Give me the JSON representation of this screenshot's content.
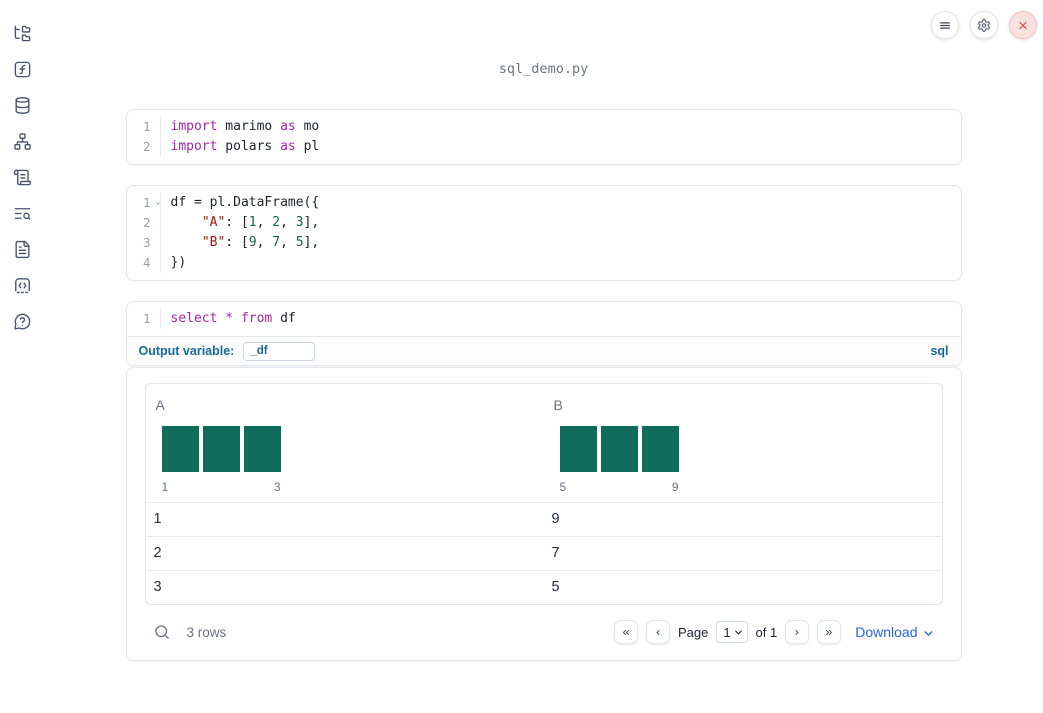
{
  "app": {
    "title": "sql_demo.py"
  },
  "topbar": {
    "buttons": [
      {
        "name": "menu",
        "icon": "hamburger-menu-icon"
      },
      {
        "name": "settings",
        "icon": "gear-icon"
      },
      {
        "name": "shutdown",
        "icon": "close-x-icon"
      }
    ]
  },
  "sidebar": {
    "items": [
      {
        "name": "file-explorer",
        "icon": "file-tree-icon"
      },
      {
        "name": "variables",
        "icon": "function-square-icon"
      },
      {
        "name": "data-sources",
        "icon": "database-icon"
      },
      {
        "name": "dependency-graph",
        "icon": "network-icon"
      },
      {
        "name": "scratchpad",
        "icon": "scroll-icon"
      },
      {
        "name": "logs",
        "icon": "text-search-icon"
      },
      {
        "name": "documentation",
        "icon": "file-text-icon"
      },
      {
        "name": "snippets",
        "icon": "code-box-icon"
      },
      {
        "name": "help",
        "icon": "help-bubble-icon"
      }
    ]
  },
  "cells": [
    {
      "name": "imports-cell",
      "lines": [
        {
          "no": "1",
          "tokens": [
            {
              "c": "kw",
              "t": "import"
            },
            {
              "c": "pl",
              "t": " marimo "
            },
            {
              "c": "kw",
              "t": "as"
            },
            {
              "c": "pl",
              "t": " mo"
            }
          ]
        },
        {
          "no": "2",
          "tokens": [
            {
              "c": "kw",
              "t": "import"
            },
            {
              "c": "pl",
              "t": " polars "
            },
            {
              "c": "kw",
              "t": "as"
            },
            {
              "c": "pl",
              "t": " pl"
            }
          ]
        }
      ]
    },
    {
      "name": "dataframe-cell",
      "lines": [
        {
          "no": "1",
          "fold": true,
          "tokens": [
            {
              "c": "pl",
              "t": "df = pl.DataFrame({"
            }
          ]
        },
        {
          "no": "2",
          "tokens": [
            {
              "c": "pl",
              "t": "    "
            },
            {
              "c": "str",
              "t": "\"A\""
            },
            {
              "c": "pl",
              "t": ": ["
            },
            {
              "c": "num",
              "t": "1"
            },
            {
              "c": "pl",
              "t": ", "
            },
            {
              "c": "num",
              "t": "2"
            },
            {
              "c": "pl",
              "t": ", "
            },
            {
              "c": "num",
              "t": "3"
            },
            {
              "c": "pl",
              "t": "],"
            }
          ]
        },
        {
          "no": "3",
          "tokens": [
            {
              "c": "pl",
              "t": "    "
            },
            {
              "c": "str",
              "t": "\"B\""
            },
            {
              "c": "pl",
              "t": ": ["
            },
            {
              "c": "num",
              "t": "9"
            },
            {
              "c": "pl",
              "t": ", "
            },
            {
              "c": "num",
              "t": "7"
            },
            {
              "c": "pl",
              "t": ", "
            },
            {
              "c": "num",
              "t": "5"
            },
            {
              "c": "pl",
              "t": "],"
            }
          ]
        },
        {
          "no": "4",
          "tokens": [
            {
              "c": "pl",
              "t": "})"
            }
          ]
        }
      ]
    },
    {
      "name": "sql-cell",
      "lines": [
        {
          "no": "1",
          "tokens": [
            {
              "c": "kw",
              "t": "select"
            },
            {
              "c": "pl",
              "t": " "
            },
            {
              "c": "kw",
              "t": "*"
            },
            {
              "c": "pl",
              "t": " "
            },
            {
              "c": "kw",
              "t": "from"
            },
            {
              "c": "pl",
              "t": " df"
            }
          ]
        }
      ],
      "footer": {
        "label": "Output variable:",
        "value": "_df",
        "badge": "sql"
      }
    }
  ],
  "table": {
    "columns": [
      {
        "label": "A",
        "hist": {
          "values": [
            1,
            1,
            1
          ],
          "min_label": "1",
          "max_label": "3"
        }
      },
      {
        "label": "B",
        "hist": {
          "values": [
            1,
            1,
            1
          ],
          "min_label": "5",
          "max_label": "9"
        }
      }
    ],
    "rows": [
      [
        "1",
        "9"
      ],
      [
        "2",
        "7"
      ],
      [
        "3",
        "5"
      ]
    ],
    "row_count": "3 rows",
    "pagination": {
      "page_label": "Page",
      "page_value": "1",
      "of_label": "of 1"
    },
    "download_label": "Download"
  },
  "chart_data": [
    {
      "type": "bar",
      "title": "A",
      "values": [
        1,
        1,
        1
      ],
      "x_min": 1,
      "x_max": 3,
      "note": "column summary histogram, 3 equal bins each of count 1"
    },
    {
      "type": "bar",
      "title": "B",
      "values": [
        1,
        1,
        1
      ],
      "x_min": 5,
      "x_max": 9,
      "note": "column summary histogram, 3 equal bins each of count 1"
    }
  ],
  "colors": {
    "histogram_bar": "#106d5b",
    "accent_blue": "#17699c",
    "link_blue": "#2563eb",
    "keyword": "#a626a4",
    "string": "#a31515",
    "number": "#116644",
    "close_button_red": "#d64c4c"
  }
}
